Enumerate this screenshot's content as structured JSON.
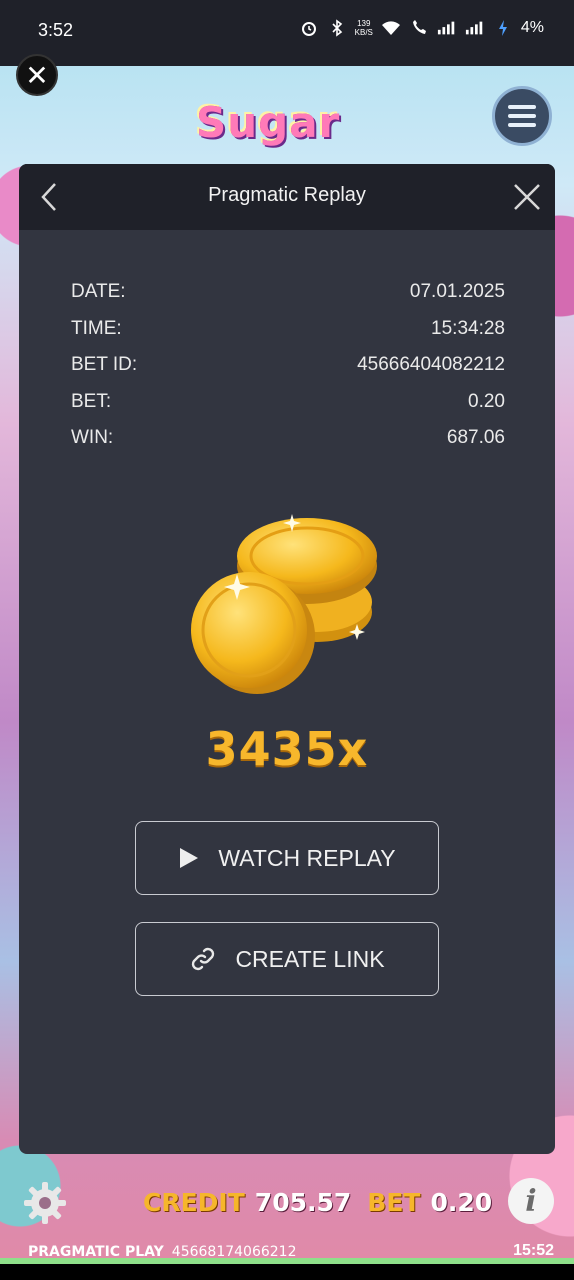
{
  "status_bar": {
    "time": "3:52",
    "speed_top": "139",
    "speed_bottom": "KB/S",
    "battery": "4%"
  },
  "game": {
    "logo_text": "Sugar",
    "close_icon": "close-icon",
    "menu_icon": "hamburger-menu-icon"
  },
  "modal": {
    "title": "Pragmatic Replay",
    "rows": [
      {
        "label": "DATE:",
        "value": "07.01.2025"
      },
      {
        "label": "TIME:",
        "value": "15:34:28"
      },
      {
        "label": "BET ID:",
        "value": "45666404082212"
      },
      {
        "label": "BET:",
        "value": "0.20"
      },
      {
        "label": "WIN:",
        "value": "687.06"
      }
    ],
    "multiplier": "3435x",
    "watch_label": "WATCH REPLAY",
    "link_label": "CREATE LINK"
  },
  "bottom": {
    "credit_label": "CREDIT",
    "credit_value": "705.57",
    "bet_label": "BET",
    "bet_value": "0.20",
    "brand": "PRAGMATIC PLAY",
    "session_id": "45668174066212",
    "clock": "15:52"
  },
  "colors": {
    "modal_bg": "#323540",
    "header_bg": "#1f2129",
    "accent_gold": "#f7b72c"
  }
}
